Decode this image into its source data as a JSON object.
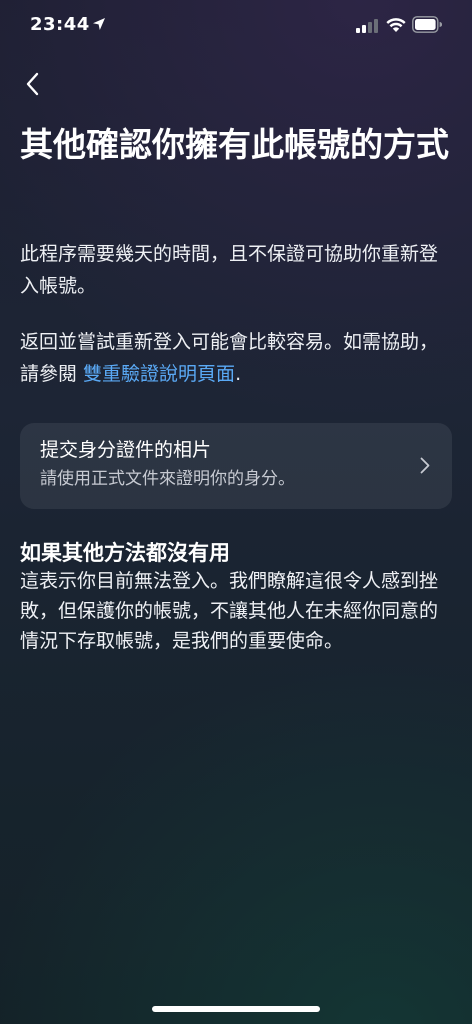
{
  "status_bar": {
    "time": "23:44",
    "location_icon": "location-arrow-icon",
    "signal_icon": "cellular-signal-icon",
    "wifi_icon": "wifi-icon",
    "battery_icon": "battery-icon"
  },
  "navigation": {
    "back_icon": "chevron-left-icon"
  },
  "title": "其他確認你擁有此帳號的方式",
  "intro_paragraph": "此程序需要幾天的時間，且不保證可協助你重新登入帳號。",
  "help_paragraph": {
    "text": "返回並嘗試重新登入可能會比較容易。如需協助，請參閱 ",
    "link_text": "雙重驗證說明頁面",
    "suffix": "."
  },
  "option_card": {
    "title": "提交身分證件的相片",
    "subtitle": "請使用正式文件來證明你的身分。",
    "icon": "chevron-right-icon"
  },
  "fallback_section": {
    "heading": "如果其他方法都沒有用",
    "body": "這表示你目前無法登入。我們瞭解這很令人感到挫敗，但保護你的帳號，不讓其他人在未經你同意的情況下存取帳號，是我們的重要使命。"
  },
  "colors": {
    "link": "#5aa9f5",
    "text": "#ffffff",
    "card_background": "rgba(255,255,255,0.075)"
  }
}
